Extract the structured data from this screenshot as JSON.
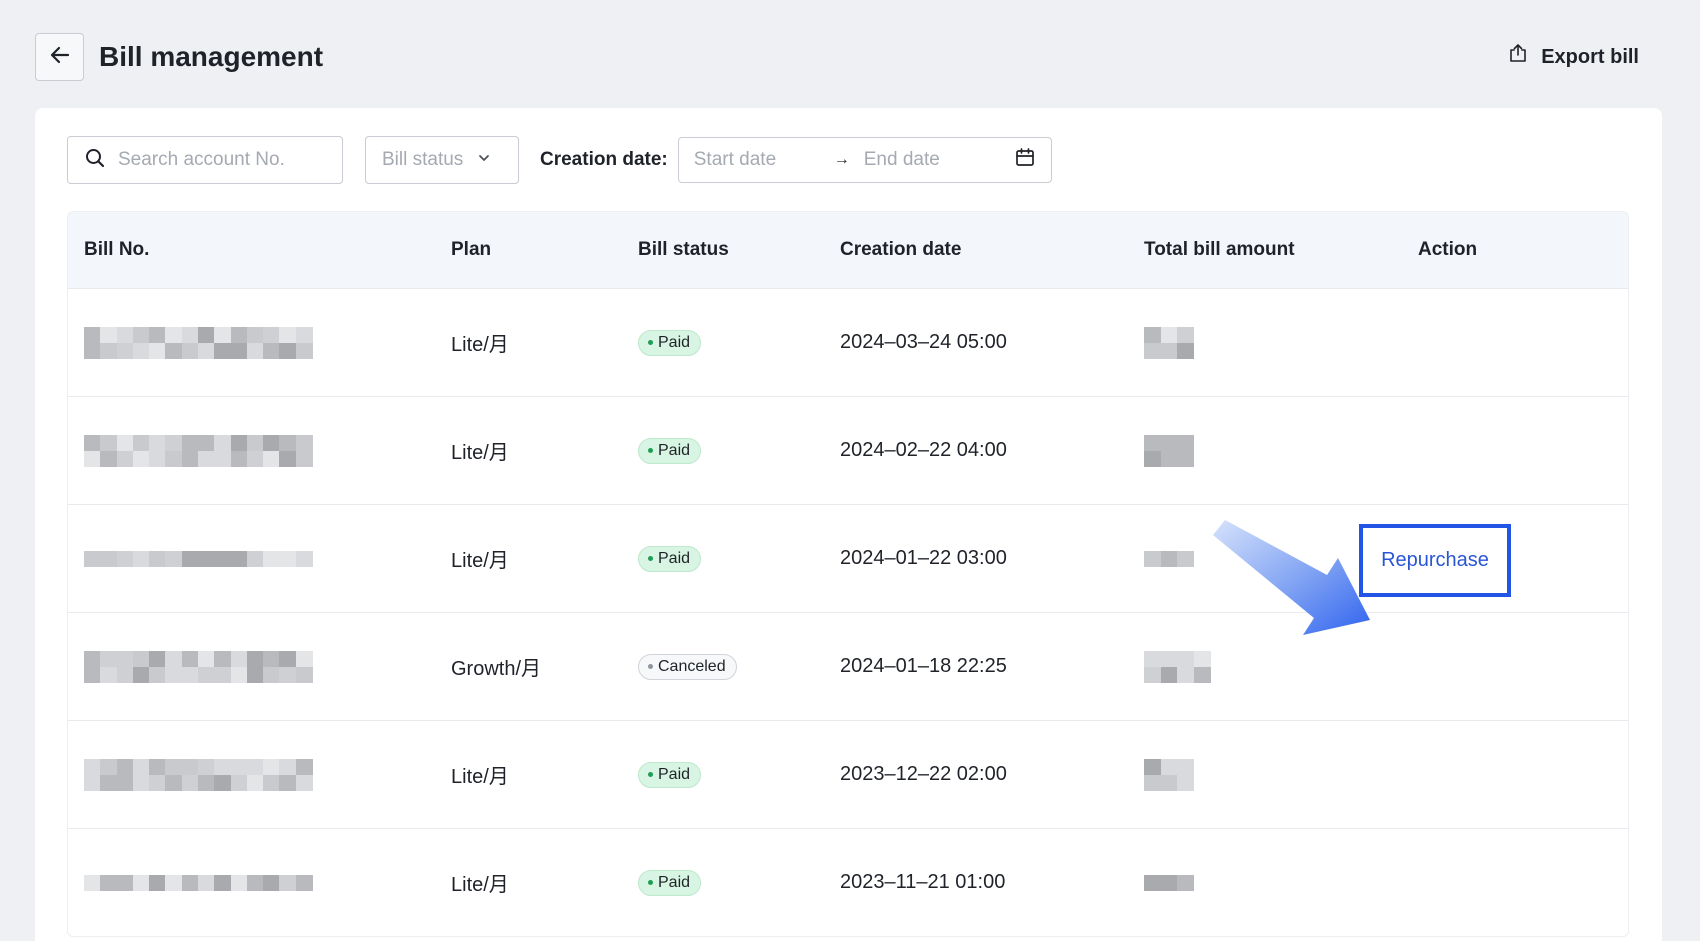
{
  "header": {
    "title": "Bill management",
    "export_label": "Export bill"
  },
  "filters": {
    "search_placeholder": "Search account No.",
    "status_placeholder": "Bill status",
    "date_label": "Creation date:",
    "start_placeholder": "Start date",
    "range_separator": "→",
    "end_placeholder": "End date"
  },
  "table": {
    "columns": [
      "Bill No.",
      "Plan",
      "Bill status",
      "Creation date",
      "Total bill amount",
      "Action"
    ],
    "rows": [
      {
        "plan": "Lite/月",
        "status": "Paid",
        "date": "2024–03–24 05:00",
        "action": ""
      },
      {
        "plan": "Lite/月",
        "status": "Paid",
        "date": "2024–02–22 04:00",
        "action": ""
      },
      {
        "plan": "Lite/月",
        "status": "Paid",
        "date": "2024–01–22 03:00",
        "action": ""
      },
      {
        "plan": "Growth/月",
        "status": "Canceled",
        "date": "2024–01–18 22:25",
        "action": "Repurchase"
      },
      {
        "plan": "Lite/月",
        "status": "Paid",
        "date": "2023–12–22 02:00",
        "action": ""
      },
      {
        "plan": "Lite/月",
        "status": "Paid",
        "date": "2023–11–21 01:00",
        "action": ""
      }
    ]
  },
  "icons": {
    "back": "arrow-left-icon",
    "export": "export-icon",
    "search": "search-icon",
    "dropdown": "chevron-down-icon",
    "calendar": "calendar-icon",
    "annotation": "pointer-arrow-icon"
  },
  "colors": {
    "highlight": "#2255e6",
    "link": "#2a56d6",
    "paid_badge": "#d7f5e2"
  }
}
